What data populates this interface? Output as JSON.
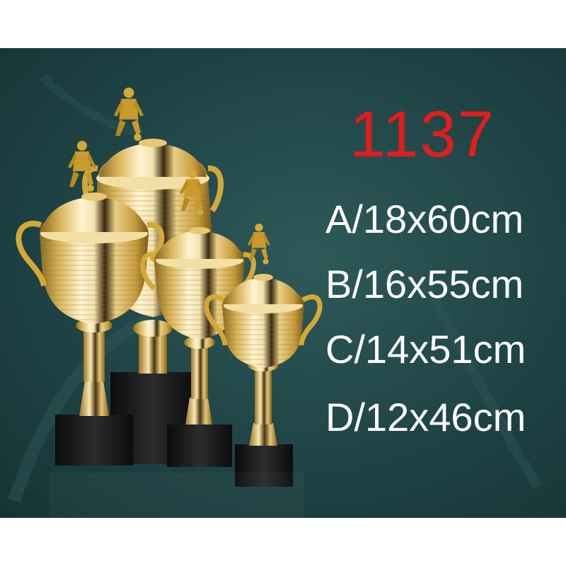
{
  "product": {
    "model_number": "1137",
    "sizes": [
      {
        "label": "A/18x60cm"
      },
      {
        "label": "B/16x55cm"
      },
      {
        "label": "C/14x51cm"
      },
      {
        "label": "D/12x46cm"
      }
    ]
  },
  "photo": {
    "subject": "four gold-plated soccer trophy cups with player figurines on black bases",
    "trophy_count": 4,
    "figurine": "soccer-player-icon"
  },
  "colors": {
    "background": "#1f4446",
    "model_number": "#e01e1e",
    "size_text": "#ffffff",
    "gold": "#d9b55a",
    "base": "#121416"
  }
}
